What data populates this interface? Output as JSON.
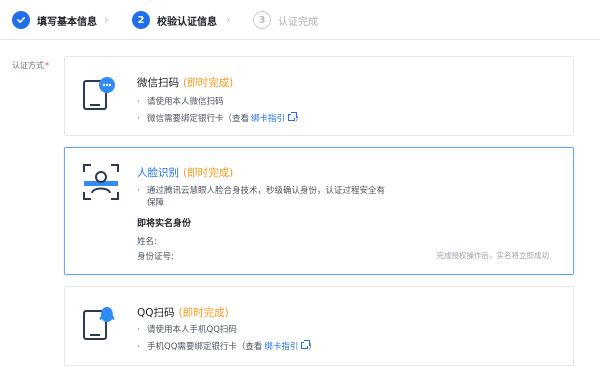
{
  "stepper": {
    "steps": [
      {
        "number": "✓",
        "label": "填写基本信息"
      },
      {
        "number": "2",
        "label": "校验认证信息"
      },
      {
        "number": "3",
        "label": "认证完成"
      }
    ],
    "arrow": "›"
  },
  "form": {
    "label": "认证方式",
    "required_mark": "*"
  },
  "options": {
    "wechat": {
      "title": "微信扫码",
      "hint": "(即时完成)",
      "lines": [
        "请使用本人微信扫码",
        "微信需要绑定银行卡（查看"
      ],
      "link_text": "绑卡指引",
      "link_suffix": "）"
    },
    "face": {
      "title": "人脸识别",
      "hint": "(即时完成)",
      "lines": [
        "通过腾讯云慧眼人脸合身技术，秒级确认身份，认证过程安全有",
        "保障"
      ],
      "subhead": "即将实名身份",
      "name_label": "姓名:",
      "id_label": "身份证号:",
      "note": "完成授权操作后，实名将立即成功"
    },
    "qq": {
      "title": "QQ扫码",
      "hint": "(即时完成)",
      "lines": [
        "请使用本人手机QQ扫码",
        "手机QQ需要绑定银行卡（查看"
      ],
      "link_text": "绑卡指引",
      "link_suffix": "）"
    }
  },
  "colors": {
    "accent": "#1f6feb",
    "hint": "#f39a1f",
    "selected_border": "#6aa7f2"
  },
  "icons": {
    "step1": "check-icon",
    "wechat": "wechat-phone-icon",
    "face": "face-scan-icon",
    "qq": "qq-phone-icon",
    "external": "external-link-icon"
  }
}
